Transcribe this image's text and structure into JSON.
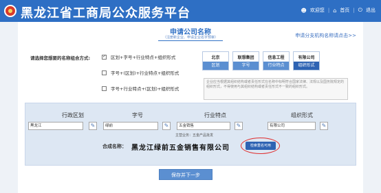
{
  "header": {
    "site_title": "黑龙江省工商局公众服务平台",
    "welcome": "欢迎您",
    "home": "首页",
    "logout": "退出"
  },
  "page": {
    "title": "申请公司名称",
    "subtitle": "（注册新企业、申请企业名字预审）",
    "branch_link": "申请分支机构名称请点击>>"
  },
  "combo": {
    "label": "请选择您想要的名称组合方式:",
    "options": [
      {
        "text": "区划+字号+行业特点+组织形式",
        "checked": true
      },
      {
        "text": "字号+(区划)+行业特点+组织形式",
        "checked": false
      },
      {
        "text": "字号+行业特点+(区划)+组织形式",
        "checked": false
      }
    ]
  },
  "cards": [
    {
      "stamp": "北京",
      "label": "区划",
      "active": false
    },
    {
      "stamp": "联想集团",
      "label": "字号",
      "active": false
    },
    {
      "stamp": "信息工程",
      "label": "行业特点",
      "active": false
    },
    {
      "stamp": "有限公司",
      "label": "组织形式",
      "active": true
    }
  ],
  "note": "企业应当根据其组织结构或者责任形式在名称中标明符合国家法律、法规以及国务院规定的组织形式，不得使用与其组织结构或者责任形式不一致的组织形式。",
  "form": {
    "headers": [
      "行政区划",
      "字号",
      "行业特点",
      "组织形式"
    ],
    "values": [
      "黑龙江",
      "绿前",
      "五金销售",
      "有限公司"
    ],
    "main_business": "主营业务：五金产品批发",
    "result_label": "合成名称：",
    "result_name": "黑龙江绿前五金销售有限公司",
    "check_button": "检索重名可用"
  },
  "save_button": "保存并下一步",
  "colors": {
    "primary": "#2e6fc4",
    "panel": "#dde7f3",
    "highlight": "#e02b2b"
  }
}
